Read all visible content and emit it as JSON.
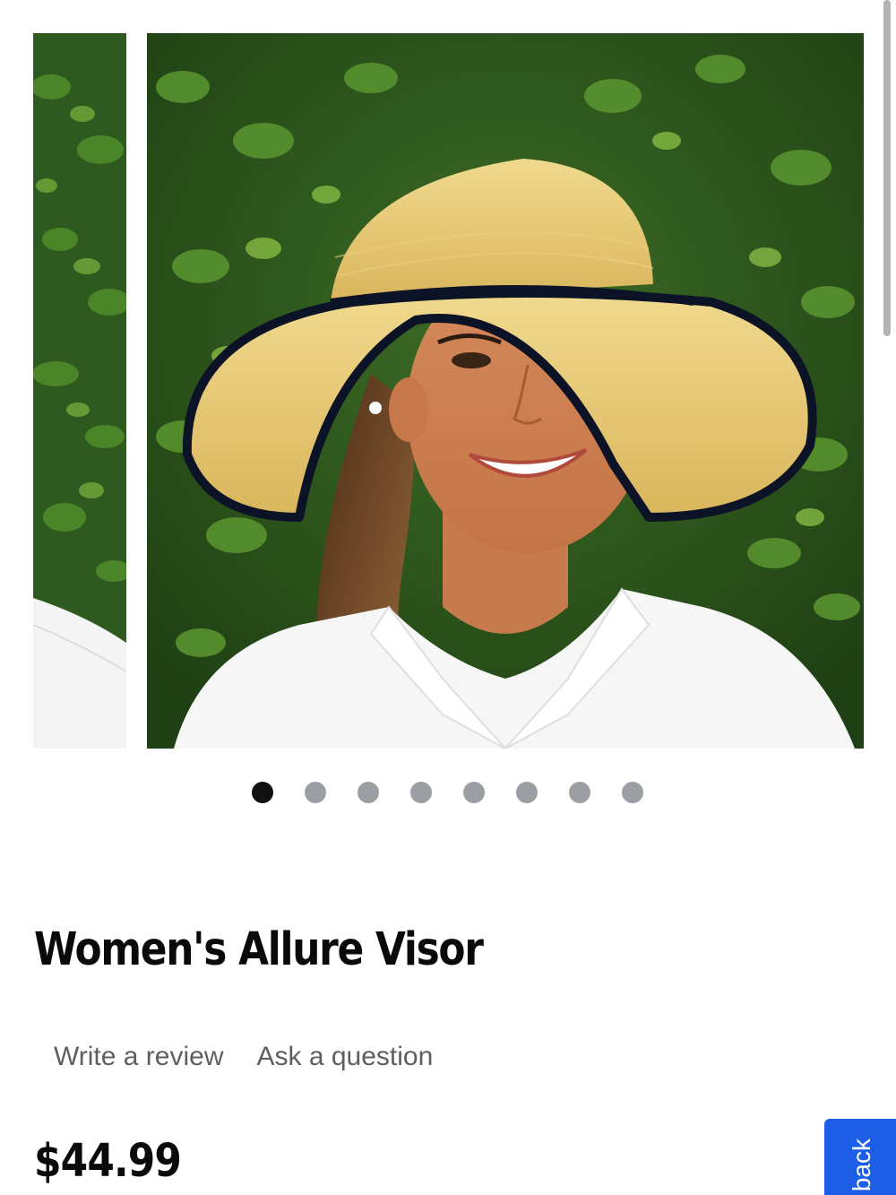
{
  "product": {
    "title": "Women's Allure Visor",
    "price": "$44.99"
  },
  "links": {
    "write_review": "Write a review",
    "ask_question": "Ask a question"
  },
  "carousel": {
    "image_count": 8,
    "active_index": 0
  },
  "feedback_tab": {
    "label": "back"
  },
  "colors": {
    "accent": "#1c5fe6",
    "dot_active": "#111111",
    "dot_inactive": "#9b9ea3",
    "link_text": "#5f5f5f"
  }
}
